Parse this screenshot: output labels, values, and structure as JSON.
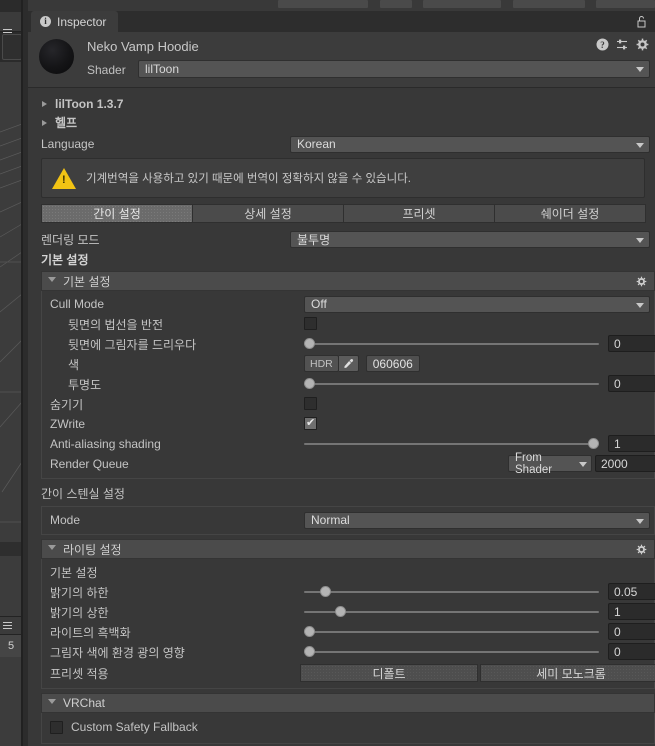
{
  "window": {
    "tab_label": "Inspector",
    "info_icon": "i",
    "lock_icon": "lock-open-icon"
  },
  "material": {
    "name": "Neko Vamp Hoodie",
    "shader_label": "Shader",
    "shader_value": "lilToon",
    "header_icons": [
      "help-icon",
      "preset-icon",
      "gear-icon"
    ]
  },
  "foldouts": {
    "version": "lilToon 1.3.7",
    "help": "헬프"
  },
  "language": {
    "label": "Language",
    "value": "Korean"
  },
  "warning": {
    "text": "기계번역을 사용하고 있기 때문에 번역이 정확하지 않을 수 있습니다."
  },
  "tabs": [
    {
      "label": "간이 설정",
      "active": true
    },
    {
      "label": "상세 설정",
      "active": false
    },
    {
      "label": "프리셋",
      "active": false
    },
    {
      "label": "쉐이더 설정",
      "active": false
    }
  ],
  "render_mode": {
    "label": "렌더링 모드",
    "value": "불투명"
  },
  "basic": {
    "heading": "기본 설정",
    "section_title": "기본 설정",
    "rows": {
      "cull_mode": {
        "label": "Cull Mode",
        "value": "Off"
      },
      "flip_backface_normal": {
        "label": "뒷면의 법선을 반전",
        "checked": false
      },
      "backface_shadow": {
        "label": "뒷면에 그림자를 드리우다",
        "value": "0",
        "fill": 0
      },
      "color": {
        "label": "색",
        "hdr_label": "HDR",
        "hex": "060606"
      },
      "alpha": {
        "label": "투명도",
        "value": "0",
        "fill": 0
      },
      "hide": {
        "label": "숨기기",
        "checked": false
      },
      "zwrite": {
        "label": "ZWrite",
        "checked": true
      },
      "aa_shading": {
        "label": "Anti-aliasing shading",
        "value": "1",
        "fill": 100
      },
      "render_queue": {
        "label": "Render Queue",
        "mode": "From Shader",
        "value": "2000"
      }
    }
  },
  "stencil": {
    "heading": "간이 스텐실 설정",
    "mode_label": "Mode",
    "mode_value": "Normal"
  },
  "lighting": {
    "section_title": "라이팅 설정",
    "sub_heading": "기본 설정",
    "rows": [
      {
        "label": "밝기의 하한",
        "value": "0.05",
        "fill": 5
      },
      {
        "label": "밝기의 상한",
        "value": "1",
        "fill": 17
      },
      {
        "label": "라이트의 흑백화",
        "value": "0",
        "fill": 0
      },
      {
        "label": "그림자 색에 환경 광의 영향",
        "value": "0",
        "fill": 0
      }
    ],
    "preset_label": "프리셋 적용",
    "preset_buttons": [
      "디폴트",
      "세미 모노크롬"
    ]
  },
  "vrchat": {
    "section_title": "VRChat",
    "safety_fallback": {
      "label": "Custom Safety Fallback",
      "checked": false
    }
  },
  "left_panel": {
    "number": "5"
  },
  "colors": {
    "panel_bg": "#383838",
    "header_bg": "#3c3c3c",
    "field_bg": "#545454",
    "numfield_bg": "#2b2b2b",
    "warning_yellow": "#f2c314",
    "text": "#c4c4c4"
  }
}
